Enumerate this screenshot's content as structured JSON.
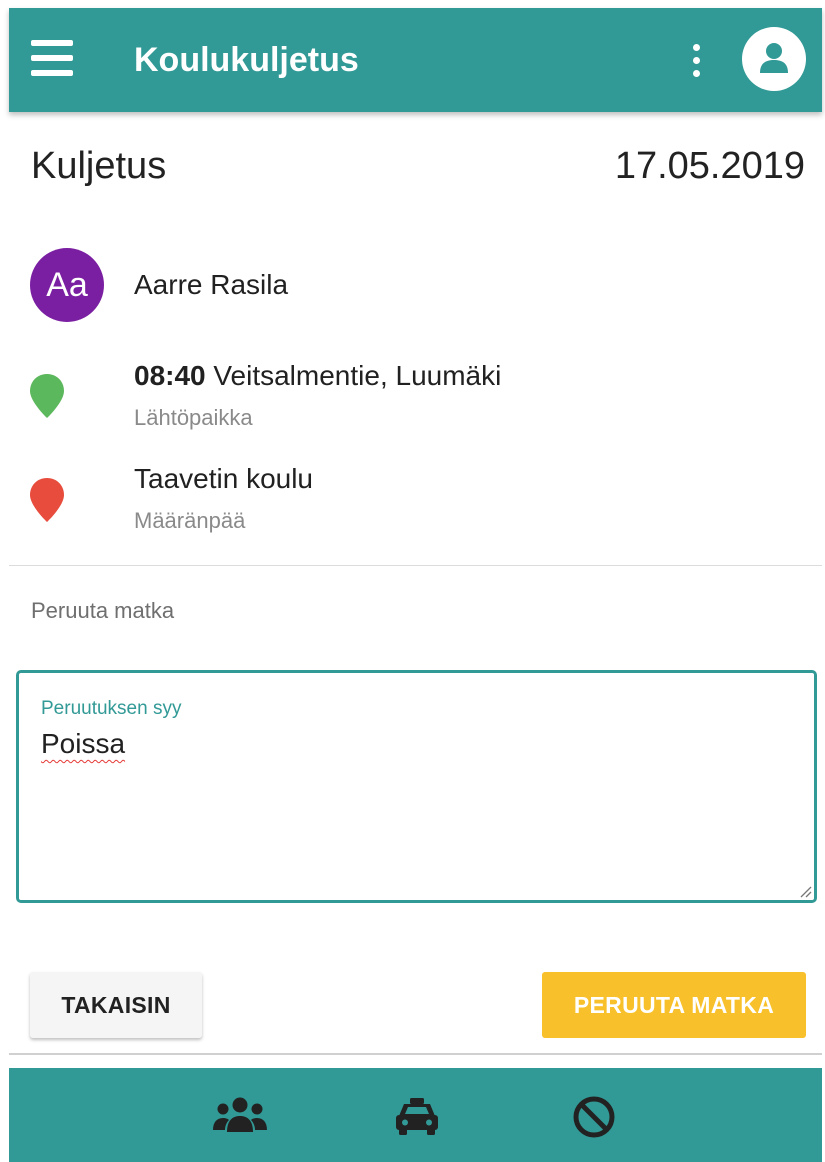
{
  "appbar": {
    "title": "Koulukuljetus",
    "menu_icon": "hamburger-menu-icon",
    "more_icon": "more-vertical-icon",
    "account_icon": "user-icon"
  },
  "header": {
    "title": "Kuljetus",
    "date": "17.05.2019"
  },
  "passenger": {
    "initials": "Aa",
    "name": "Aarre Rasila",
    "avatar_color": "#7b1fa2"
  },
  "origin": {
    "time": "08:40",
    "place": "Veitsalmentie, Luumäki",
    "label": "Lähtöpaikka",
    "pin_color": "#5cb85c"
  },
  "destination": {
    "place": "Taavetin koulu",
    "label": "Määränpää",
    "pin_color": "#e74c3c"
  },
  "cancel_form": {
    "section_title": "Peruuta matka",
    "reason_label": "Peruutuksen syy",
    "reason_value": "Poissa"
  },
  "actions": {
    "back_label": "TAKAISIN",
    "cancel_label": "PERUUTA MATKA"
  },
  "bottom_nav": {
    "items": [
      {
        "icon": "users-icon"
      },
      {
        "icon": "taxi-icon"
      },
      {
        "icon": "ban-icon"
      }
    ]
  },
  "colors": {
    "primary": "#329a96",
    "accent": "#f8c02a"
  }
}
